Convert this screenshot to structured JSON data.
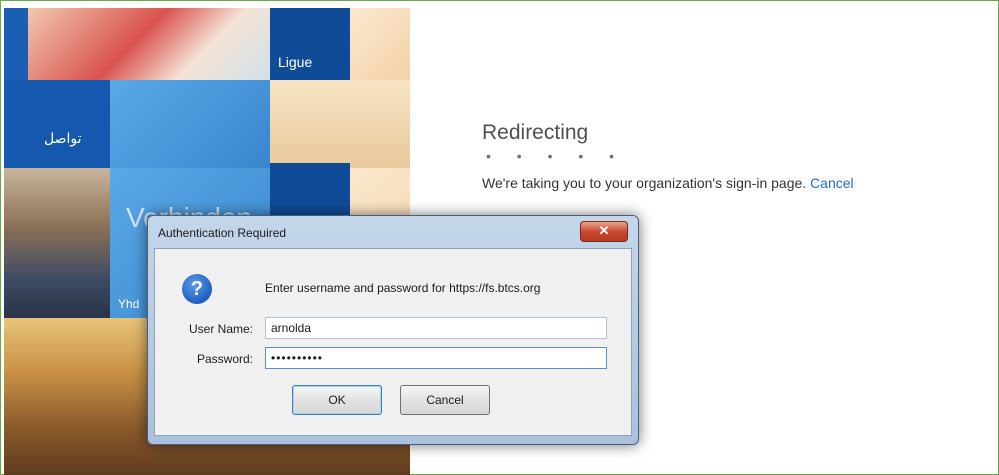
{
  "background": {
    "tile_label_ligue": "Ligue",
    "tile_label_arabic": "تواصل",
    "tile_label_big": "Verbinden",
    "tile_label_small": "Yhd"
  },
  "redirect": {
    "title": "Redirecting",
    "dots": "• • • • •",
    "message": "We're taking you to your organization's sign-in page.",
    "cancel_link": "Cancel"
  },
  "dialog": {
    "title": "Authentication Required",
    "close_label": "✕",
    "prompt": "Enter username and password for https://fs.btcs.org",
    "username_label": "User Name:",
    "username_value": "arnolda",
    "password_label": "Password:",
    "password_value": "••••••••••",
    "ok_label": "OK",
    "cancel_label": "Cancel"
  },
  "colors": {
    "link": "#1a6fd0",
    "tile_blue": "#1658ad",
    "frame_green": "#6aa84f"
  }
}
